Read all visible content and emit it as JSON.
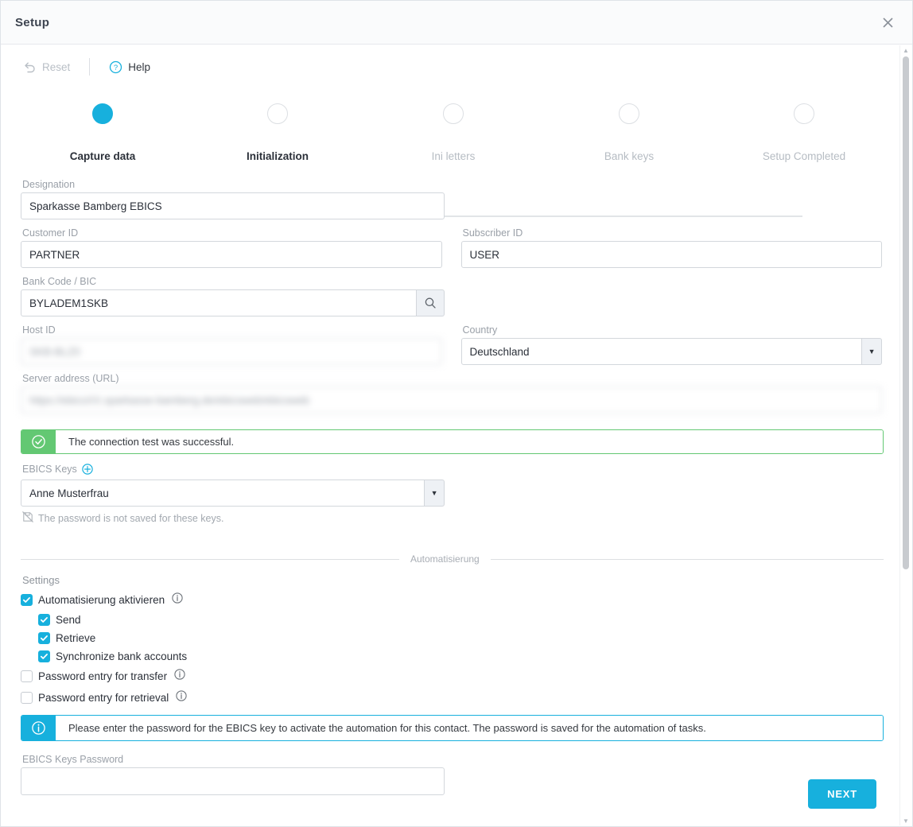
{
  "window": {
    "title": "Setup",
    "close_label": "×"
  },
  "toolbar": {
    "reset_label": "Reset",
    "help_label": "Help"
  },
  "stepper": {
    "steps": [
      {
        "label": "Capture data",
        "state": "active"
      },
      {
        "label": "Initialization",
        "state": "done"
      },
      {
        "label": "Ini letters",
        "state": "future"
      },
      {
        "label": "Bank keys",
        "state": "future"
      },
      {
        "label": "Setup Completed",
        "state": "future"
      }
    ]
  },
  "form": {
    "designation": {
      "label": "Designation",
      "value": "Sparkasse Bamberg EBICS"
    },
    "customer_id": {
      "label": "Customer ID",
      "value": "PARTNER"
    },
    "subscriber_id": {
      "label": "Subscriber ID",
      "value": "USER"
    },
    "bank_code": {
      "label": "Bank Code / BIC",
      "value": "BYLADEM1SKB"
    },
    "host_id": {
      "label": "Host ID",
      "value": "SKB-BLZ0"
    },
    "country": {
      "label": "Country",
      "value": "Deutschland"
    },
    "server_url": {
      "label": "Server address (URL)",
      "value": "https://ebicsXX.sparkasse-bamberg.de/ebicsweb/ebicsweb"
    },
    "ebics_keys": {
      "label": "EBICS Keys",
      "value": "Anne Musterfrau"
    },
    "ebics_password": {
      "label": "EBICS Keys Password",
      "value": "",
      "placeholder": ""
    }
  },
  "alerts": {
    "connection_success": "The connection test was successful.",
    "password_note": "The password is not saved for these keys.",
    "automation_info": "Please enter the password for the EBICS key to activate the automation for this contact. The password is saved for the automation of tasks."
  },
  "divider": {
    "caption": "Automatisierung"
  },
  "settings": {
    "title": "Settings",
    "items": [
      {
        "label": "Automatisierung aktivieren",
        "checked": true,
        "indent": false,
        "info": true
      },
      {
        "label": "Send",
        "checked": true,
        "indent": true,
        "info": false
      },
      {
        "label": "Retrieve",
        "checked": true,
        "indent": true,
        "info": false
      },
      {
        "label": "Synchronize bank accounts",
        "checked": true,
        "indent": true,
        "info": false
      },
      {
        "label": "Password entry for transfer",
        "checked": false,
        "indent": false,
        "info": true
      },
      {
        "label": "Password entry for retrieval",
        "checked": false,
        "indent": false,
        "info": true
      }
    ]
  },
  "footer": {
    "next_label": "NEXT"
  },
  "colors": {
    "accent": "#17b0dd",
    "success": "#63c873",
    "label": "#9aa0a8",
    "text": "#2b3039"
  }
}
